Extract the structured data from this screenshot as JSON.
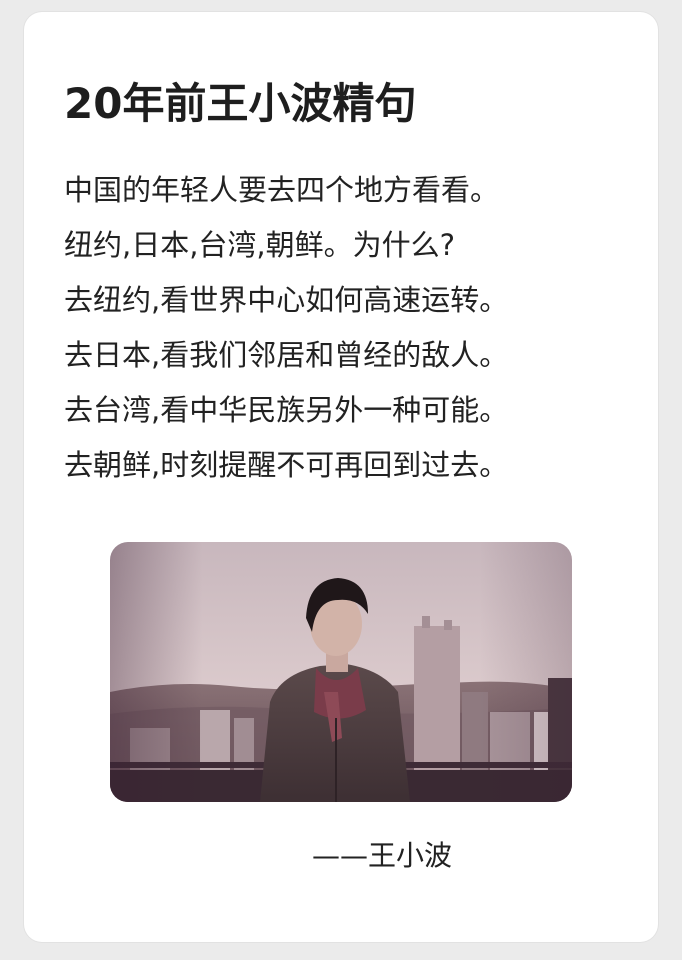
{
  "title": "20年前王小波精句",
  "lines": [
    "中国的年轻人要去四个地方看看。",
    "纽约,日本,台湾,朝鲜。为什么?",
    "去纽约,看世界中心如何高速运转。",
    "去日本,看我们邻居和曾经的敌人。",
    "去台湾,看中华民族另外一种可能。",
    "去朝鲜,时刻提醒不可再回到过去。"
  ],
  "signature": "——王小波",
  "photo": {
    "subject": "man-in-dark-coat-and-scarf-over-city-skyline"
  }
}
